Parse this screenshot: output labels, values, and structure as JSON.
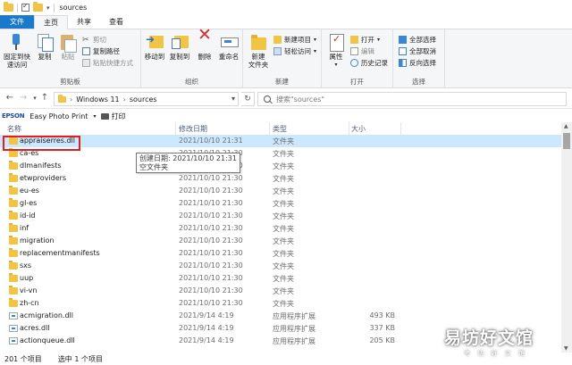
{
  "window": {
    "title": "sources"
  },
  "ribbon_tabs": [
    "文件",
    "主页",
    "共享",
    "查看"
  ],
  "ribbon": {
    "clipboard": {
      "label": "剪贴板",
      "pin": "固定到快速访问",
      "pin_line1": "固定到快",
      "pin_line2": "速访问",
      "copy": "复制",
      "paste": "粘贴",
      "cut": "剪切",
      "copy_path": "复制路径",
      "paste_shortcut": "粘贴快捷方式"
    },
    "organize": {
      "label": "组织",
      "move_to": "移动到",
      "copy_to": "复制到",
      "delete": "删除",
      "rename": "重命名"
    },
    "new": {
      "label": "新建",
      "new_item": "新建项目",
      "easy_access": "轻松访问",
      "new_folder_line1": "新建",
      "new_folder_line2": "文件夹"
    },
    "open": {
      "label": "打开",
      "properties": "属性",
      "open": "打开",
      "edit": "编辑",
      "history": "历史记录"
    },
    "select": {
      "label": "选择",
      "select_all": "全部选择",
      "select_none": "全部取消",
      "invert": "反向选择"
    }
  },
  "address": {
    "crumbs": [
      "Windows 11",
      "sources"
    ],
    "search_placeholder": "搜索\"sources\""
  },
  "epson": {
    "brand": "EPSON",
    "app": "Easy Photo Print",
    "print": "打印"
  },
  "columns": {
    "name": "名称",
    "date": "修改日期",
    "type": "类型",
    "size": "大小"
  },
  "files": [
    {
      "name": "appraiserres.dll",
      "date": "2021/10/10 21:31",
      "type": "文件夹",
      "size": "",
      "kind": "folder",
      "selected": true
    },
    {
      "name": "ca-es",
      "date": "2021/10/10 21:30",
      "type": "文件夹",
      "size": "",
      "kind": "folder"
    },
    {
      "name": "dlmanifests",
      "date": "2021/10/10 21:30",
      "type": "文件夹",
      "size": "",
      "kind": "folder"
    },
    {
      "name": "etwproviders",
      "date": "2021/10/10 21:30",
      "type": "文件夹",
      "size": "",
      "kind": "folder"
    },
    {
      "name": "eu-es",
      "date": "2021/10/10 21:30",
      "type": "文件夹",
      "size": "",
      "kind": "folder"
    },
    {
      "name": "gl-es",
      "date": "2021/10/10 21:30",
      "type": "文件夹",
      "size": "",
      "kind": "folder"
    },
    {
      "name": "id-id",
      "date": "2021/10/10 21:30",
      "type": "文件夹",
      "size": "",
      "kind": "folder"
    },
    {
      "name": "inf",
      "date": "2021/10/10 21:30",
      "type": "文件夹",
      "size": "",
      "kind": "folder"
    },
    {
      "name": "migration",
      "date": "2021/10/10 21:30",
      "type": "文件夹",
      "size": "",
      "kind": "folder"
    },
    {
      "name": "replacementmanifests",
      "date": "2021/10/10 21:30",
      "type": "文件夹",
      "size": "",
      "kind": "folder"
    },
    {
      "name": "sxs",
      "date": "2021/10/10 21:30",
      "type": "文件夹",
      "size": "",
      "kind": "folder"
    },
    {
      "name": "uup",
      "date": "2021/10/10 21:30",
      "type": "文件夹",
      "size": "",
      "kind": "folder"
    },
    {
      "name": "vi-vn",
      "date": "2021/10/10 21:30",
      "type": "文件夹",
      "size": "",
      "kind": "folder"
    },
    {
      "name": "zh-cn",
      "date": "2021/10/10 21:30",
      "type": "文件夹",
      "size": "",
      "kind": "folder"
    },
    {
      "name": "acmigration.dll",
      "date": "2021/9/14 4:19",
      "type": "应用程序扩展",
      "size": "493 KB",
      "kind": "file"
    },
    {
      "name": "acres.dll",
      "date": "2021/9/14 4:19",
      "type": "应用程序扩展",
      "size": "337 KB",
      "kind": "file"
    },
    {
      "name": "actionqueue.dll",
      "date": "2021/9/14 4:19",
      "type": "应用程序扩展",
      "size": "205 KB",
      "kind": "file"
    }
  ],
  "tooltip": {
    "line1": "创建日期: 2021/10/10 21:31",
    "line2": "空文件夹"
  },
  "status": {
    "count": "201 个项目",
    "selected": "选中 1 个项目"
  },
  "watermark": {
    "title": "易坊好文馆",
    "subtitle": "考 坊 好 文 馆"
  }
}
